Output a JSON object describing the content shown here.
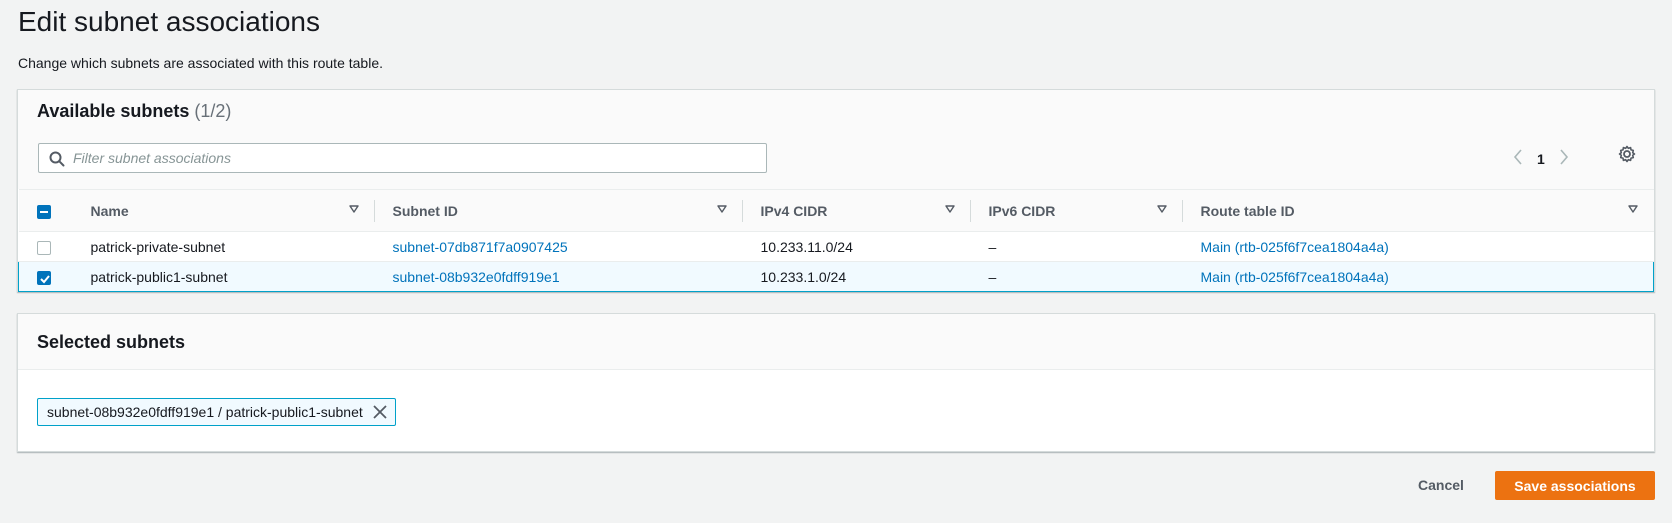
{
  "page": {
    "title": "Edit subnet associations",
    "description": "Change which subnets are associated with this route table."
  },
  "available": {
    "heading": "Available subnets",
    "count": "(1/2)",
    "search_placeholder": "Filter subnet associations",
    "page_number": "1",
    "columns": [
      "Name",
      "Subnet ID",
      "IPv4 CIDR",
      "IPv6 CIDR",
      "Route table ID"
    ],
    "rows": [
      {
        "checked": false,
        "name": "patrick-private-subnet",
        "subnet_id": "subnet-07db871f7a0907425",
        "ipv4": "10.233.11.0/24",
        "ipv6": "–",
        "route_table": "Main (rtb-025f6f7cea1804a4a)"
      },
      {
        "checked": true,
        "name": "patrick-public1-subnet",
        "subnet_id": "subnet-08b932e0fdff919e1",
        "ipv4": "10.233.1.0/24",
        "ipv6": "–",
        "route_table": "Main (rtb-025f6f7cea1804a4a)"
      }
    ]
  },
  "selected": {
    "heading": "Selected subnets",
    "token": "subnet-08b932e0fdff919e1 / patrick-public1-subnet"
  },
  "actions": {
    "cancel": "Cancel",
    "save": "Save associations"
  },
  "colors": {
    "link": "#0073bb",
    "primary": "#ec7211",
    "selection": "#00a1c9"
  }
}
